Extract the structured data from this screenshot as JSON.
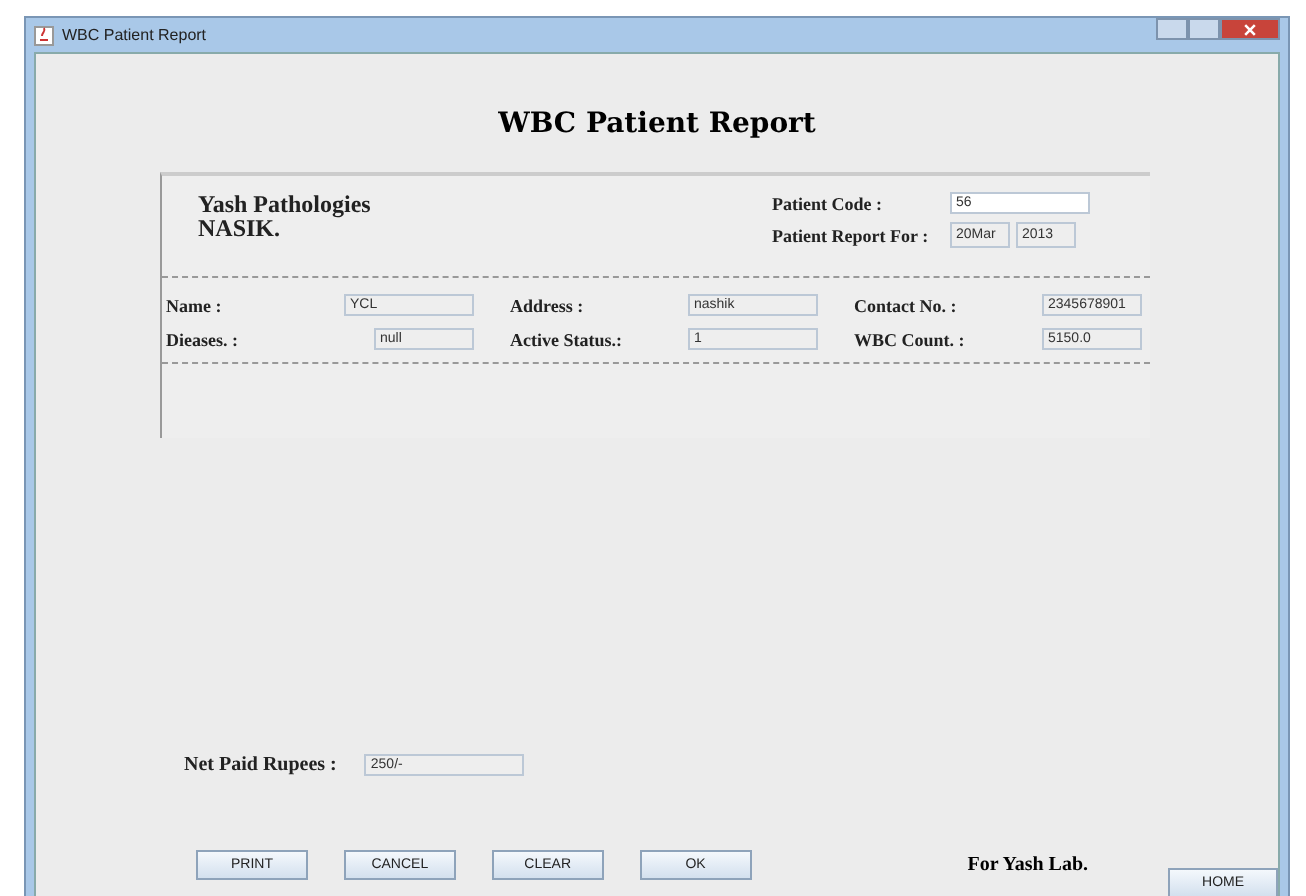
{
  "window": {
    "title": "WBC Patient Report"
  },
  "heading": "WBC Patient Report",
  "lab": {
    "name": "Yash Pathologies",
    "city": "NASIK."
  },
  "patient_code": {
    "label": "Patient Code  :",
    "value": "56"
  },
  "report_for": {
    "label": "Patient Report For  :",
    "day_month": "20Mar",
    "year": "2013"
  },
  "fields": [
    {
      "label": "Name  :",
      "value": "YCL"
    },
    {
      "label": "Address   :",
      "value": "nashik"
    },
    {
      "label": "Contact No.  :",
      "value": "2345678901"
    },
    {
      "label": "Dieases.  :",
      "value": "null"
    },
    {
      "label": "Active Status.:",
      "value": "1"
    },
    {
      "label": "WBC Count.  :",
      "value": "5150.0"
    }
  ],
  "net_paid": {
    "label": "Net Paid Rupees   :",
    "value": "250/-"
  },
  "buttons": [
    "PRINT",
    "CANCEL",
    "CLEAR",
    "OK"
  ],
  "signature": "For Yash Lab.",
  "home_button": "HOME"
}
